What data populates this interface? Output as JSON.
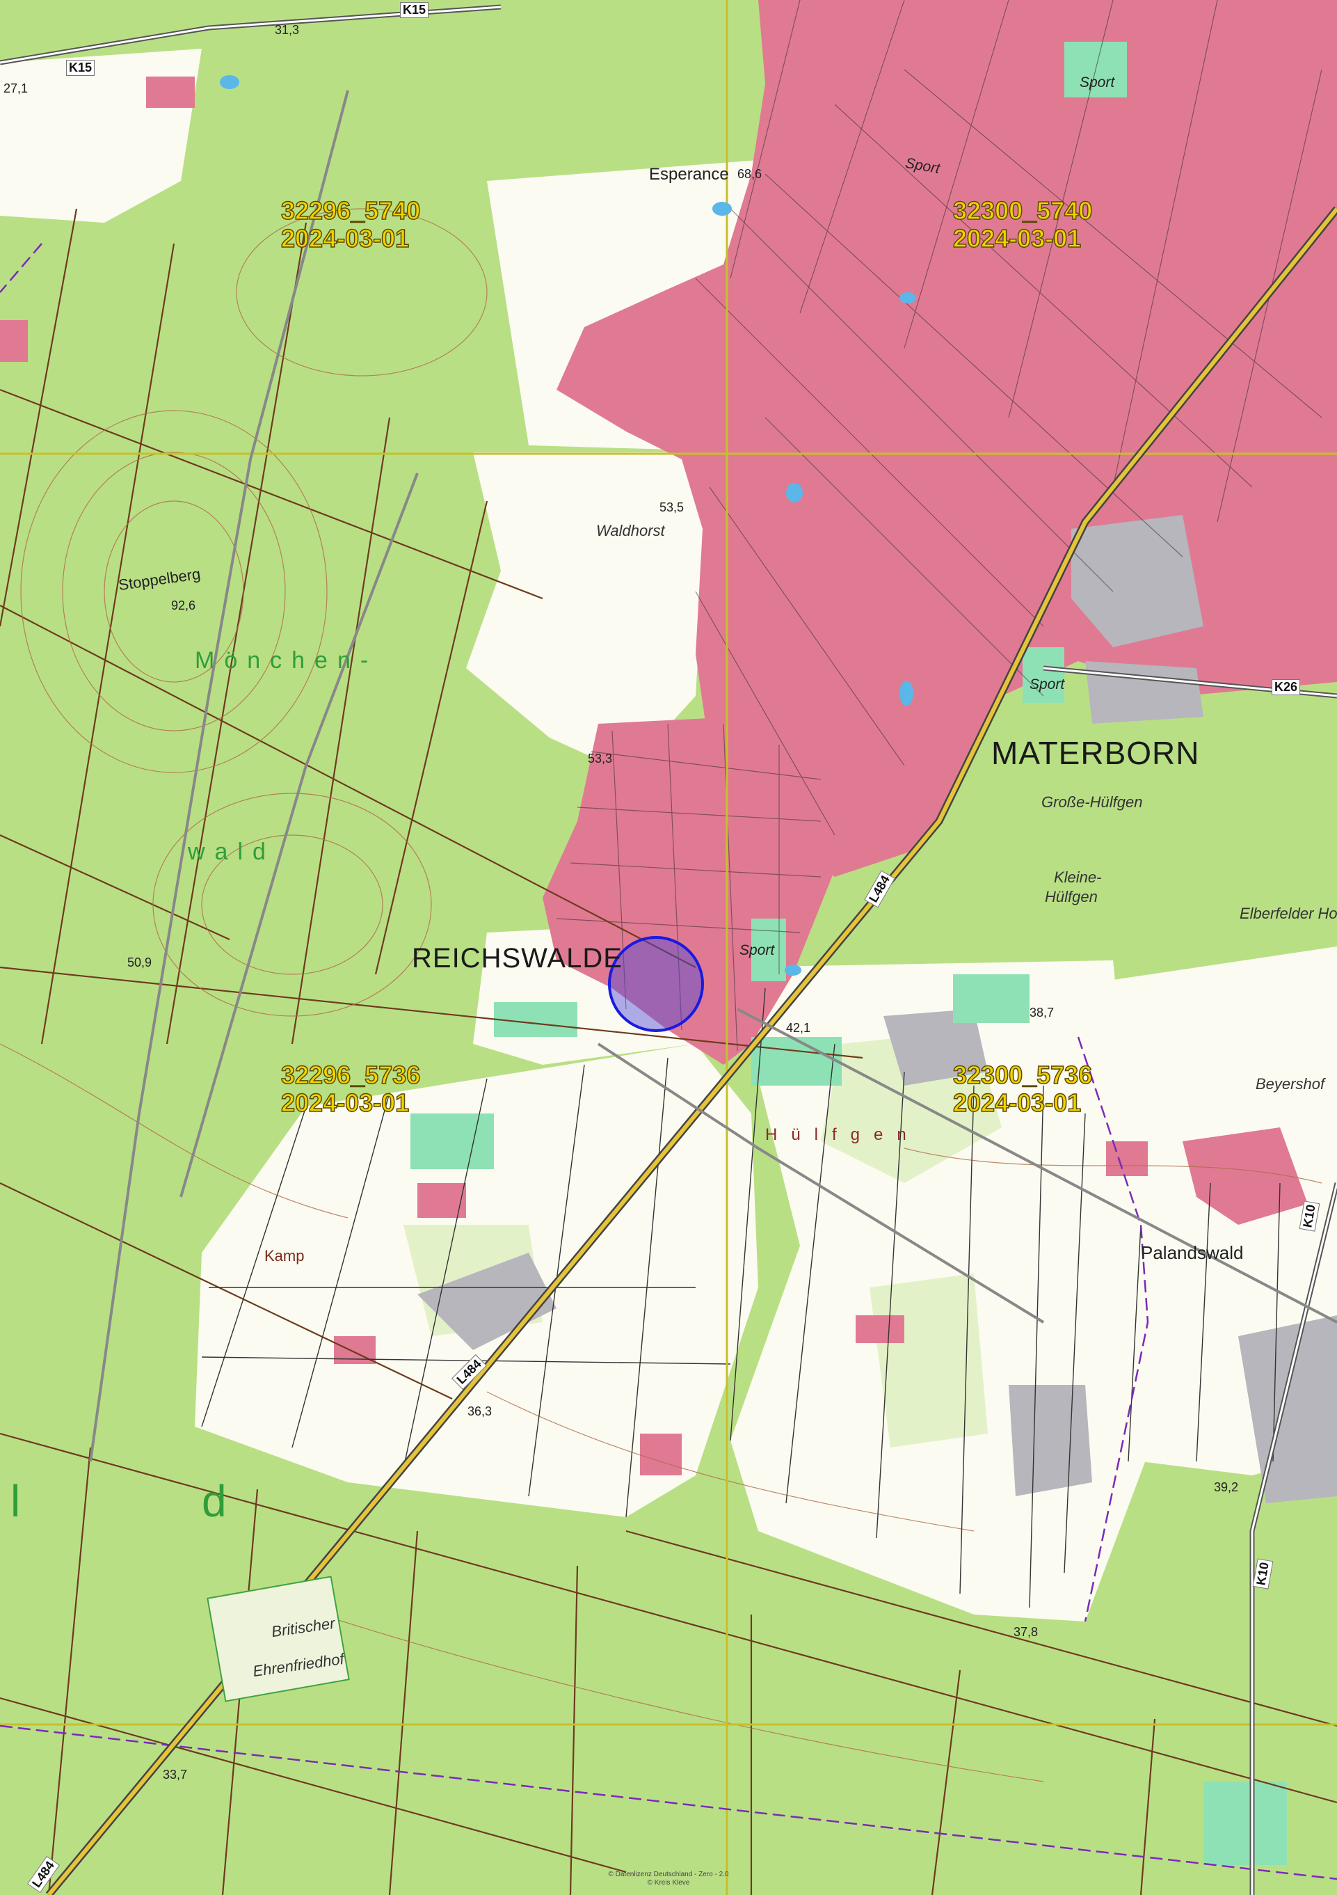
{
  "places": {
    "reichswalde": "REICHSWALDE",
    "materborn": "MATERBORN",
    "esperance": "Esperance",
    "waldhorst": "Waldhorst",
    "stoppelberg": "Stoppelberg",
    "moenchen": "Mönchen-",
    "wald": "wald",
    "grosse_hufgen": "Große-Hülfgen",
    "kleine_hufgen_1": "Kleine-",
    "kleine_hufgen_2": "Hülfgen",
    "elberfelder": "Elberfelder Ho",
    "beyershof": "Beyershof",
    "hufgen": "Hülfgen",
    "kamp": "Kamp",
    "palandswald": "Palandswald",
    "britischer": "Britischer",
    "ehrenfriedhof": "Ehrenfriedhof",
    "d_big": "d",
    "l_big": "l"
  },
  "sport_labels": [
    "Sport",
    "Sport",
    "Sport",
    "Sport"
  ],
  "roads": {
    "k15_a": "K15",
    "k15_b": "K15",
    "k26": "K26",
    "l484_a": "L484",
    "l484_b": "L484",
    "l484_c": "L484",
    "k10_a": "K10",
    "k10_b": "K10"
  },
  "heights": {
    "h1": "31,3",
    "h2": "27,1",
    "h3": "68,6",
    "h4": "53,5",
    "h5": "92,6",
    "h6": "53,3",
    "h7": "50,9",
    "h8": "42,1",
    "h9": "38,7",
    "h10": "36,3",
    "h11": "39,2",
    "h12": "37,8",
    "h13": "33,7"
  },
  "tiles": [
    {
      "id": "32296_5740",
      "date": "2024-03-01"
    },
    {
      "id": "32300_5740",
      "date": "2024-03-01"
    },
    {
      "id": "32296_5736",
      "date": "2024-03-01"
    },
    {
      "id": "32300_5736",
      "date": "2024-03-01"
    }
  ],
  "copyright": {
    "line1": "© Datenlizenz Deutschland - Zero - 2.0",
    "line2": "© Kreis Kleve"
  },
  "colors": {
    "forest": "#b9df85",
    "settlement": "#e07a93",
    "open_land": "#fbfbf1",
    "meadow": "#e3f1c8",
    "industry": "#b6b6bc",
    "sports": "#8ee1b4",
    "tile_grid": "#c8bf2a",
    "tile_label": "#f3d300",
    "marker": "#2a2ad0"
  },
  "marker": {
    "shape": "circle",
    "color": "blue",
    "label": "REICHSWALDE"
  }
}
